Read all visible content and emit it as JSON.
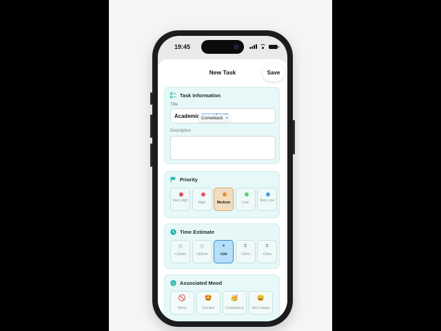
{
  "status_bar": {
    "time": "19:45"
  },
  "nav": {
    "title": "New Task",
    "save_label": "Save"
  },
  "task_information": {
    "heading": "Task Information",
    "title_label": "Title",
    "title_value_plain": "Academic ",
    "title_value_selected": "comeback",
    "suggestion": "Comeback",
    "suggestion_close": "×",
    "description_label": "Description",
    "description_value": ""
  },
  "priority": {
    "heading": "Priority",
    "options": [
      {
        "label": "Very High",
        "color": "#e0475a",
        "selected": false
      },
      {
        "label": "High",
        "color": "#e05566",
        "selected": false
      },
      {
        "label": "Medium",
        "color": "#ef8a2e",
        "selected": true
      },
      {
        "label": "Low",
        "color": "#5ccf73",
        "selected": false
      },
      {
        "label": "Very Low",
        "color": "#4a9fe0",
        "selected": false
      }
    ]
  },
  "time_estimate": {
    "heading": "Time Estimate",
    "options": [
      {
        "label": "<15min",
        "icon": "clock-icon",
        "selected": false
      },
      {
        "label": "<30min",
        "icon": "clock-icon",
        "selected": false
      },
      {
        "label": "<1hr",
        "icon": "clock-icon",
        "selected": true
      },
      {
        "label": "<2hrs",
        "icon": "hourglass-icon",
        "selected": false
      },
      {
        "label": "<2hrs",
        "icon": "hourglass-icon",
        "selected": false
      }
    ]
  },
  "associated_mood": {
    "heading": "Associated Mood",
    "options": [
      {
        "label": "None",
        "emoji": "🚫"
      },
      {
        "label": "Excited",
        "emoji": "🤩"
      },
      {
        "label": "Celebratory",
        "emoji": "🥳"
      },
      {
        "label": "Very Happy",
        "emoji": "😄"
      }
    ]
  },
  "colors": {
    "accent": "#25b3ad",
    "card_bg": "#e6f8f7",
    "selected_priority": "#f1dcc0",
    "selected_time": "#b9def7"
  }
}
